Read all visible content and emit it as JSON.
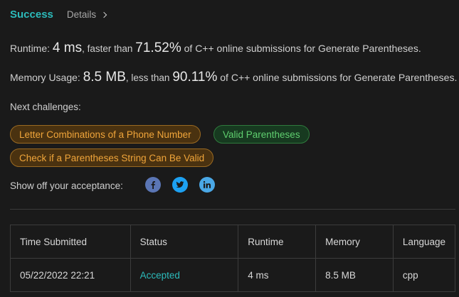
{
  "header": {
    "status": "Success",
    "details_label": "Details"
  },
  "runtime": {
    "label": "Runtime:",
    "value": "4 ms",
    "mid_text": ", faster than",
    "percent": "71.52%",
    "tail_text": "of C++ online submissions for Generate Parentheses."
  },
  "memory": {
    "label": "Memory Usage:",
    "value": "8.5 MB",
    "mid_text": ", less than",
    "percent": "90.11%",
    "tail_text": "of C++ online submissions for Generate Parentheses."
  },
  "next_challenges": {
    "label": "Next challenges:",
    "items": [
      {
        "label": "Letter Combinations of a Phone Number",
        "difficulty": "medium"
      },
      {
        "label": "Valid Parentheses",
        "difficulty": "easy"
      },
      {
        "label": "Check if a Parentheses String Can Be Valid",
        "difficulty": "medium"
      }
    ]
  },
  "share": {
    "label": "Show off your acceptance:",
    "icons": [
      "facebook-icon",
      "twitter-icon",
      "linkedin-icon"
    ]
  },
  "colors": {
    "accent": "#2cbbbb",
    "medium": "#f0a53a",
    "easy": "#5fcf6f",
    "facebook": "#5b76b5",
    "twitter": "#1da1f2",
    "linkedin": "#4aa8e6"
  },
  "table": {
    "headers": [
      "Time Submitted",
      "Status",
      "Runtime",
      "Memory",
      "Language"
    ],
    "rows": [
      [
        "05/22/2022 22:21",
        "Accepted",
        "4 ms",
        "8.5 MB",
        "cpp"
      ]
    ]
  }
}
